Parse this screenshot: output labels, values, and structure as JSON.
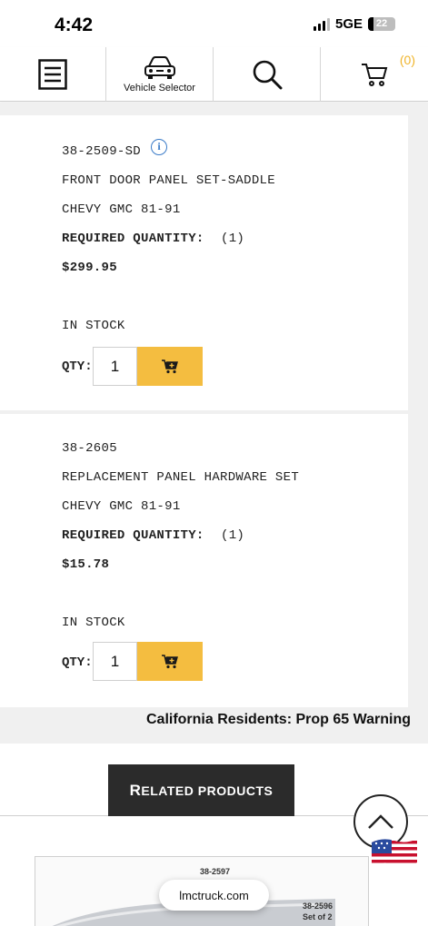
{
  "status_bar": {
    "time": "4:42",
    "network": "5GE",
    "battery": "22"
  },
  "nav": {
    "vehicle_selector_label": "Vehicle Selector",
    "cart_count": "(0)"
  },
  "products": [
    {
      "sku": "38-2509-SD",
      "name": "FRONT DOOR PANEL SET-SADDLE",
      "fitment": "CHEVY GMC 81-91",
      "required_quantity_label": "REQUIRED QUANTITY:",
      "required_quantity": "(1)",
      "price": "$299.95",
      "stock_status": "IN STOCK",
      "qty_label": "QTY:",
      "qty_value": "1"
    },
    {
      "sku": "38-2605",
      "name": "REPLACEMENT PANEL HARDWARE SET",
      "fitment": "CHEVY GMC 81-91",
      "required_quantity_label": "REQUIRED QUANTITY:",
      "required_quantity": "(1)",
      "price": "$15.78",
      "stock_status": "IN STOCK",
      "qty_label": "QTY:",
      "qty_value": "1"
    }
  ],
  "prop65_warning": "California Residents: Prop 65 Warning",
  "related_products": {
    "first_letter": "R",
    "rest": "ELATED PRODUCTS"
  },
  "product_image": {
    "label_1": "38-2597",
    "label_2a": "38-2596",
    "label_2b": "Set of 2"
  },
  "url_pill": "lmctruck.com",
  "colors": {
    "accent": "#f4bd40",
    "cart_count": "#f0b429",
    "dark_button": "#2b2b2b",
    "info_blue": "#3a7bc8"
  },
  "icons": [
    "hamburger-menu-icon",
    "car-icon",
    "search-icon",
    "cart-icon",
    "info-icon",
    "add-to-cart-icon",
    "chevron-up-icon",
    "us-flag-icon"
  ]
}
